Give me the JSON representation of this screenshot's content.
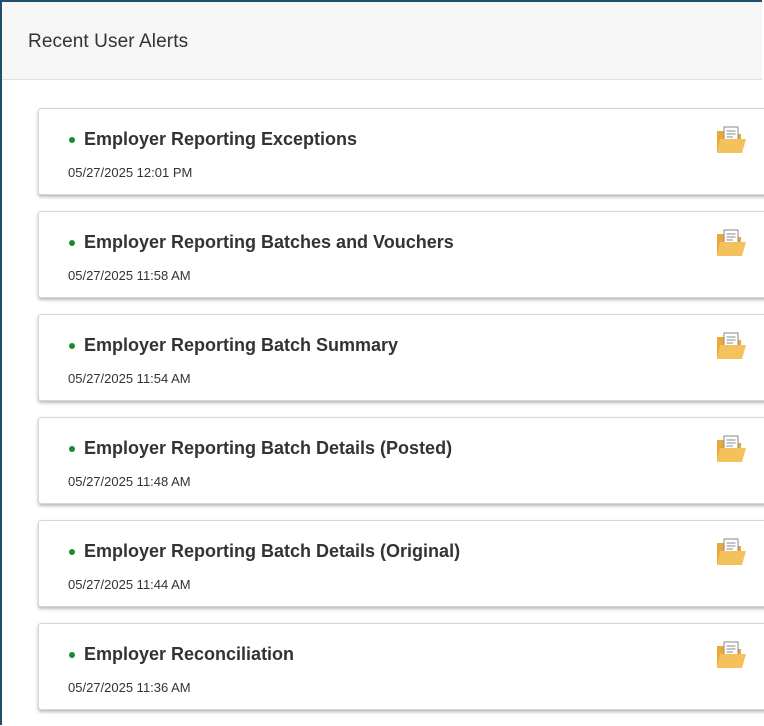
{
  "panel": {
    "title": "Recent User Alerts"
  },
  "alerts": [
    {
      "title": "Employer Reporting Exceptions",
      "timestamp": "05/27/2025 12:01 PM",
      "icon": "open-folder-icon",
      "status_color": "#1a8a2e"
    },
    {
      "title": "Employer Reporting Batches and Vouchers",
      "timestamp": "05/27/2025 11:58 AM",
      "icon": "open-folder-icon",
      "status_color": "#1a8a2e"
    },
    {
      "title": "Employer Reporting Batch Summary",
      "timestamp": "05/27/2025 11:54 AM",
      "icon": "open-folder-icon",
      "status_color": "#1a8a2e"
    },
    {
      "title": "Employer Reporting Batch Details (Posted)",
      "timestamp": "05/27/2025 11:48 AM",
      "icon": "open-folder-icon",
      "status_color": "#1a8a2e"
    },
    {
      "title": "Employer Reporting Batch Details (Original)",
      "timestamp": "05/27/2025 11:44 AM",
      "icon": "open-folder-icon",
      "status_color": "#1a8a2e"
    },
    {
      "title": "Employer Reconciliation",
      "timestamp": "05/27/2025 11:36 AM",
      "icon": "open-folder-icon",
      "status_color": "#1a8a2e"
    }
  ],
  "colors": {
    "accent_border": "#1f4e6b",
    "status_dot": "#1a8a2e",
    "folder": "#f0b64a"
  }
}
